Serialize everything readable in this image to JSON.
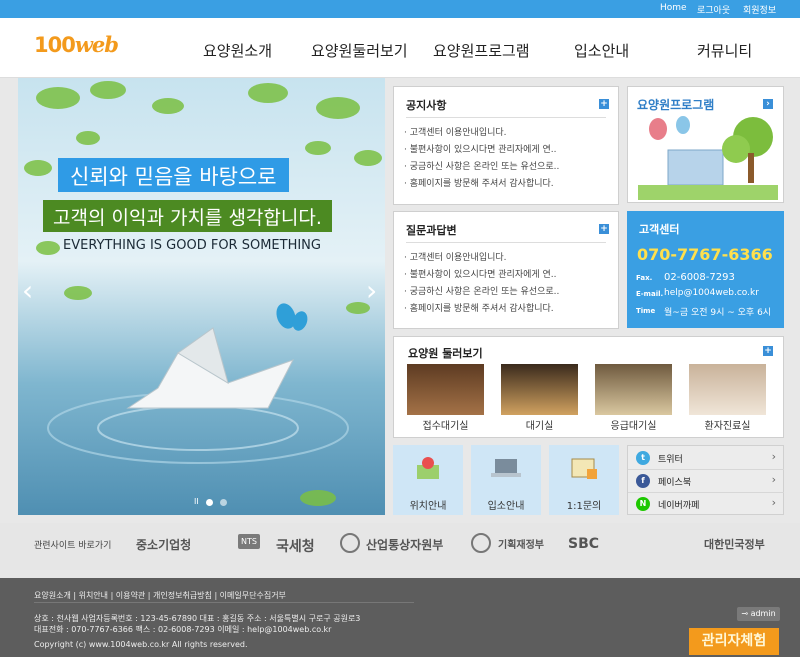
{
  "topbar": {
    "home": "Home",
    "logout": "로그아웃",
    "member": "회원정보"
  },
  "header": {
    "logo_num": "100",
    "logo_web": "web",
    "nav": [
      "요양원소개",
      "요양원둘러보기",
      "요양원프로그램",
      "입소안내",
      "커뮤니티"
    ]
  },
  "hero": {
    "line1": "신뢰와 믿음을 바탕으로",
    "line2": "고객의 이익과 가치를 생각합니다.",
    "line3": "EVERYTHING IS GOOD FOR SOMETHING",
    "prev": "‹",
    "next": "›",
    "pause": "II"
  },
  "notice": {
    "title": "공지사항",
    "plus": "+",
    "items": [
      "고객센터 이용안내입니다.",
      "불편사항이 있으시다면 관리자에게 연..",
      "궁금하신 사항은 온라인 또는 유선으로..",
      "홈페이지를 방문해 주셔서 감사합니다."
    ]
  },
  "qna": {
    "title": "질문과답변",
    "plus": "+",
    "items": [
      "고객센터 이용안내입니다.",
      "불편사항이 있으시다면 관리자에게 연..",
      "궁금하신 사항은 온라인 또는 유선으로..",
      "홈페이지를 방문해 주셔서 감사합니다."
    ]
  },
  "program": {
    "title": "요양원프로그램",
    "arrow": "›"
  },
  "customer": {
    "title": "고객센터",
    "phone": "070-7767-6366",
    "fax_label": "Fax.",
    "fax": "02-6008-7293",
    "email_label": "E-mail.",
    "email": "help@1004web.co.kr",
    "time_label": "Time",
    "time": "월~금 오전 9시 ~ 오후 6시"
  },
  "gallery": {
    "title": "요양원 둘러보기",
    "plus": "+",
    "items": [
      "접수대기실",
      "대기실",
      "응급대기실",
      "환자진료실"
    ]
  },
  "quick": [
    "위치안내",
    "입소안내",
    "1:1문의"
  ],
  "sns": [
    {
      "label": "트위터",
      "icon": "t",
      "color": "#3fa9e0"
    },
    {
      "label": "페이스북",
      "icon": "f",
      "color": "#3b5998"
    },
    {
      "label": "네이버까페",
      "icon": "N",
      "color": "#1ec800"
    }
  ],
  "partners": {
    "label": "관련사이트 바로가기",
    "logos": [
      "중소기업청",
      "국세청",
      "산업통상자원부",
      "기획재정부",
      "SBC",
      "대한민국정부"
    ],
    "nts": "NTS"
  },
  "footer": {
    "links": "요양원소개 | 위치안내 | 이용약관 | 개인정보취급방침 | 이메일무단수집거부",
    "address": "상호 : 천사웹  사업자등록번호 : 123-45-67890  대표 : 홍길동  주소 : 서울특별시 구로구 공원로3",
    "contact": "대표전화 : 070-7767-6366  팩스 : 02-6008-7293  이메일 : help@1004web.co.kr",
    "copyright": "Copyright (c) www.1004web.co.kr All rights reserved.",
    "admin": "admin",
    "admin_exp": "관리자체험"
  },
  "colors": {
    "accent": "#3a9fe3",
    "brand_orange": "#f39a1c",
    "customer_bg": "#3a9fe3",
    "phone_yellow": "#ffe04d"
  }
}
